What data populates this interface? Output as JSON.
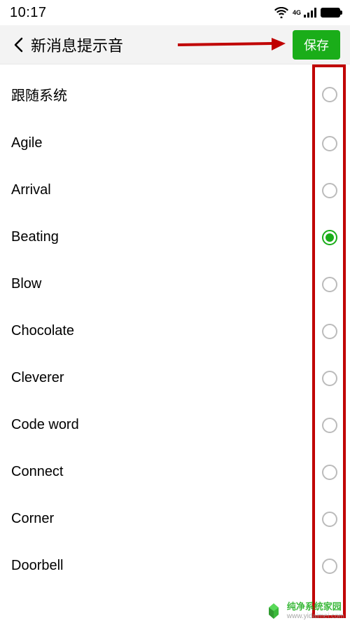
{
  "status": {
    "time": "10:17",
    "network_type": "4G"
  },
  "header": {
    "title": "新消息提示音",
    "save_label": "保存"
  },
  "sounds": [
    {
      "label": "跟随系统",
      "selected": false
    },
    {
      "label": "Agile",
      "selected": false
    },
    {
      "label": "Arrival",
      "selected": false
    },
    {
      "label": "Beating",
      "selected": true
    },
    {
      "label": "Blow",
      "selected": false
    },
    {
      "label": "Chocolate",
      "selected": false
    },
    {
      "label": "Cleverer",
      "selected": false
    },
    {
      "label": "Code word",
      "selected": false
    },
    {
      "label": "Connect",
      "selected": false
    },
    {
      "label": "Corner",
      "selected": false
    },
    {
      "label": "Doorbell",
      "selected": false
    }
  ],
  "watermark": {
    "title": "纯净系统家园",
    "url": "www.yidaimei.com"
  },
  "annotation": {
    "arrow_color": "#c00000",
    "box_color": "#c00000"
  }
}
